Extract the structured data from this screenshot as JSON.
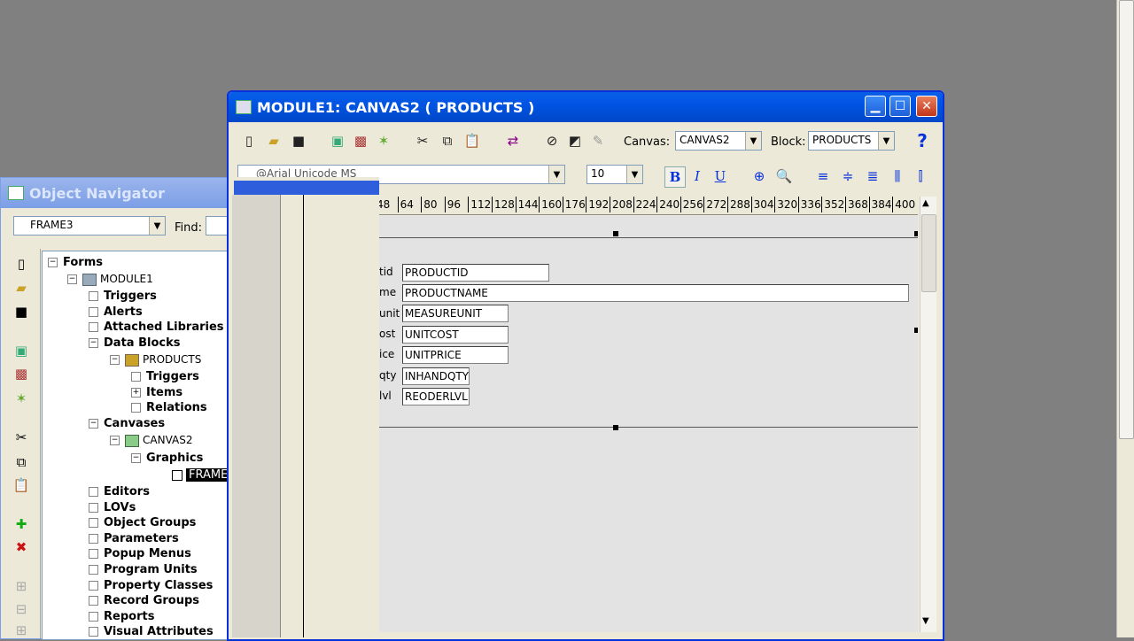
{
  "navigator": {
    "title": "Object Navigator",
    "selector_value": "FRAME3",
    "find_label": "Find:",
    "tree": {
      "forms": "Forms",
      "module1": "MODULE1",
      "triggers": "Triggers",
      "alerts": "Alerts",
      "attached_libraries": "Attached Libraries",
      "data_blocks": "Data Blocks",
      "products": "PRODUCTS",
      "block_triggers": "Triggers",
      "items": "Items",
      "relations": "Relations",
      "canvases": "Canvases",
      "canvas2": "CANVAS2",
      "graphics": "Graphics",
      "frame": "FRAME",
      "editors": "Editors",
      "lovs": "LOVs",
      "object_groups": "Object Groups",
      "parameters": "Parameters",
      "popup_menus": "Popup Menus",
      "program_units": "Program Units",
      "property_classes": "Property Classes",
      "record_groups": "Record Groups",
      "reports": "Reports",
      "visual_attributes": "Visual Attributes"
    }
  },
  "layout_editor": {
    "title": "MODULE1: CANVAS2 ( PRODUCTS )",
    "canvas_label": "Canvas:",
    "canvas_value": "CANVAS2",
    "block_label": "Block:",
    "block_value": "PRODUCTS",
    "help": "?",
    "font_value": "@Arial Unicode MS",
    "size_value": "10",
    "bold": "B",
    "italic": "I",
    "underline": "U",
    "ruler": [
      "48",
      "64",
      "80",
      "96",
      "112",
      "128",
      "144",
      "160",
      "176",
      "192",
      "208",
      "224",
      "240",
      "256",
      "272",
      "288",
      "304",
      "320",
      "336",
      "352",
      "368",
      "384",
      "400"
    ],
    "prompts": [
      "tid",
      "me",
      "unit",
      "ost",
      "ice",
      "qty",
      "lvl"
    ],
    "fields": [
      "PRODUCTID",
      "PRODUCTNAME",
      "MEASUREUNIT",
      "UNITCOST",
      "UNITPRICE",
      "INHANDQTY",
      "REODERLVL"
    ]
  },
  "colors": {
    "title_active": "#0054E3",
    "title_inactive": "#7B9EE6",
    "dialog_face": "#ECE9D8",
    "desktop": "#808080",
    "canvas_bg": "#E3E3E3"
  }
}
